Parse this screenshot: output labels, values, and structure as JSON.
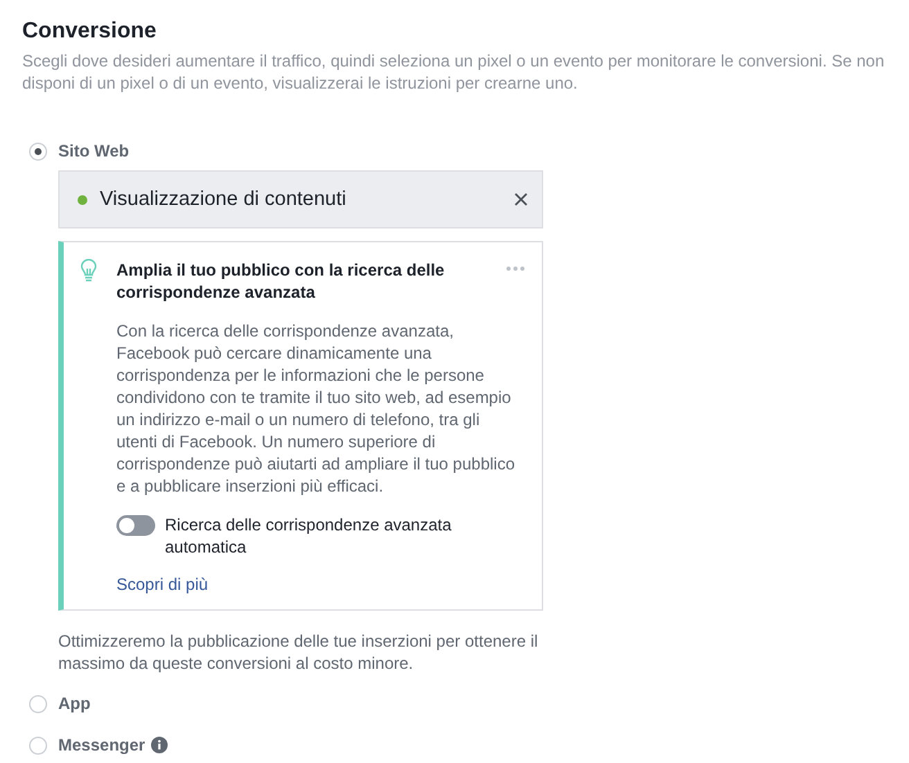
{
  "section": {
    "title": "Conversione",
    "description": "Scegli dove desideri aumentare il traffico, quindi seleziona un pixel o un evento per monitorare le conversioni. Se non disponi di un pixel o di un evento, visualizzerai le istruzioni per crearne uno."
  },
  "options": [
    {
      "label": "Sito Web",
      "selected": true,
      "info": false,
      "details": {
        "event": {
          "label": "Visualizzazione di contenuti",
          "color": "#6fb33e"
        },
        "tip": {
          "title": "Amplia il tuo pubblico con la ricerca delle corrispondenze avanzata",
          "body": "Con la ricerca delle corrispondenze avanzata, Facebook può cercare dinamicamente una corrispondenza per le informazioni che le persone condividono con te tramite il tuo sito web, ad esempio un indirizzo e-mail o un numero di telefono, tra gli utenti di Facebook. Un numero superiore di corrispondenze può aiutarti ad ampliare il tuo pubblico e a pubblicare inserzioni più efficaci.",
          "toggle": {
            "label": "Ricerca delle corrispondenze avanzata automatica",
            "on": false
          },
          "link": "Scopri di più"
        },
        "note": "Ottimizzeremo la pubblicazione delle tue inserzioni per ottenere il massimo da queste conversioni al costo minore."
      }
    },
    {
      "label": "App",
      "selected": false,
      "info": false
    },
    {
      "label": "Messenger",
      "selected": false,
      "info": true
    }
  ]
}
